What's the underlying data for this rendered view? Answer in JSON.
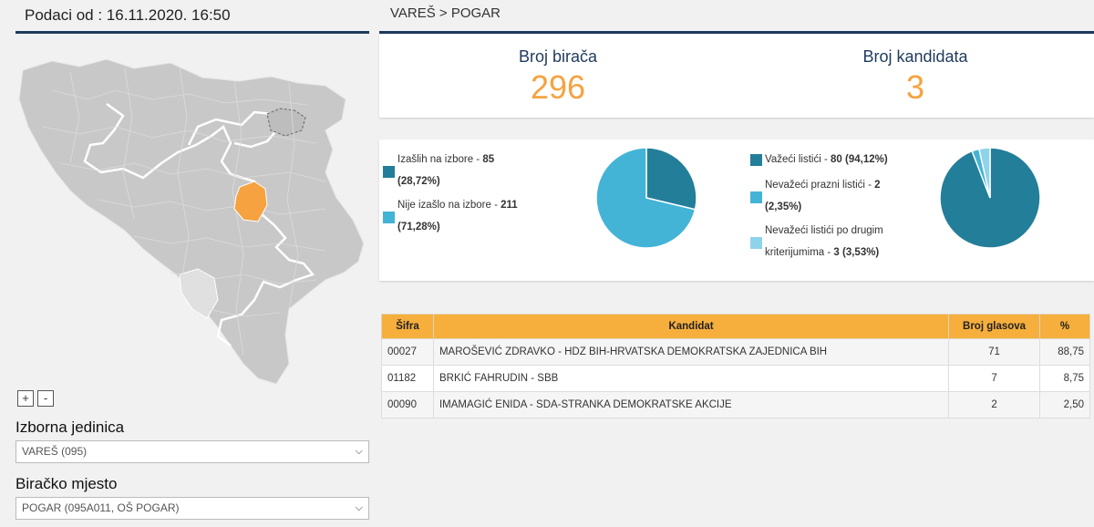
{
  "header": {
    "date_label": "Podaci od : 16.11.2020. 16:50"
  },
  "map": {
    "zoom_in": "+",
    "zoom_out": "-",
    "colors": {
      "land": "#c8c8c8",
      "highlight": "#f6a240",
      "border": "#ffffff"
    }
  },
  "filters": {
    "unit_label": "Izborna jedinica",
    "unit_value": "VAREŠ (095)",
    "station_label": "Biračko mjesto",
    "station_value": "POGAR (095A011, OŠ POGAR)"
  },
  "breadcrumb": "VAREŠ > POGAR",
  "stats": {
    "voters_label": "Broj birača",
    "voters_value": "296",
    "candidates_label": "Broj kandidata",
    "candidates_value": "3"
  },
  "turnout": {
    "items": [
      {
        "label": "Izašlih na izbore - ",
        "value": "85",
        "pct": "(28,72%)",
        "color": "#237e99"
      },
      {
        "label": "Nije izašlo na izbore - ",
        "value": "211",
        "pct": "(71,28%)",
        "color": "#43b4d6"
      }
    ],
    "fractions": [
      0.2872,
      0.7128
    ]
  },
  "ballots": {
    "items": [
      {
        "label": "Važeći listići - ",
        "value": "80",
        "pct": "(94,12%)",
        "color": "#237e99"
      },
      {
        "label": "Nevažeći prazni listići - ",
        "value": "2",
        "pct": "(2,35%)",
        "color": "#43b4d6"
      },
      {
        "label": "Nevažeći listići po drugim kriterijumima - ",
        "value": "3",
        "pct": "(3,53%)",
        "color": "#8fd3ea"
      }
    ],
    "fractions": [
      0.9412,
      0.0235,
      0.0353
    ]
  },
  "table": {
    "headers": [
      "Šifra",
      "Kandidat",
      "Broj glasova",
      "%"
    ],
    "rows": [
      {
        "code": "00027",
        "candidate": "MAROŠEVIĆ ZDRAVKO - HDZ BIH-HRVATSKA DEMOKRATSKA ZAJEDNICA BIH",
        "votes": "71",
        "pct": "88,75"
      },
      {
        "code": "01182",
        "candidate": "BRKIĆ FAHRUDIN - SBB",
        "votes": "7",
        "pct": "8,75"
      },
      {
        "code": "00090",
        "candidate": "IMAMAGIĆ ENIDA - SDA-STRANKA DEMOKRATSKE AKCIJE",
        "votes": "2",
        "pct": "2,50"
      }
    ]
  }
}
